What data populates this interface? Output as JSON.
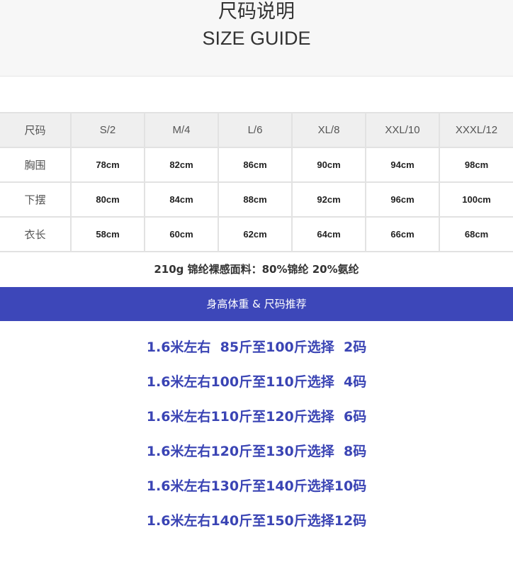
{
  "header": {
    "title_cn": "尺码说明",
    "title_en": "SIZE GUIDE"
  },
  "size_table": {
    "header_label": "尺码",
    "sizes": [
      "S/2",
      "M/4",
      "L/6",
      "XL/8",
      "XXL/10",
      "XXXL/12"
    ],
    "rows": [
      {
        "label": "胸围",
        "values": [
          "78cm",
          "82cm",
          "86cm",
          "90cm",
          "94cm",
          "98cm"
        ]
      },
      {
        "label": "下摆",
        "values": [
          "80cm",
          "84cm",
          "88cm",
          "92cm",
          "96cm",
          "100cm"
        ]
      },
      {
        "label": "衣长",
        "values": [
          "58cm",
          "60cm",
          "62cm",
          "64cm",
          "66cm",
          "68cm"
        ]
      }
    ]
  },
  "material_text": "210g 锦纶裸感面料：80%锦纶 20%氨纶",
  "banner_text": "身高体重 & 尺码推荐",
  "recommendations": [
    "1.6米左右  85斤至100斤选择  2码",
    "1.6米左右100斤至110斤选择  4码",
    "1.6米左右110斤至120斤选择  6码",
    "1.6米左右120斤至130斤选择  8码",
    "1.6米左右130斤至140斤选择10码",
    "1.6米左右140斤至150斤选择12码"
  ],
  "colors": {
    "banner_bg": "#3d47b9",
    "recommendation_text": "#3a44b4",
    "header_bg": "#f7f7f7",
    "table_header_bg": "#efefef"
  }
}
